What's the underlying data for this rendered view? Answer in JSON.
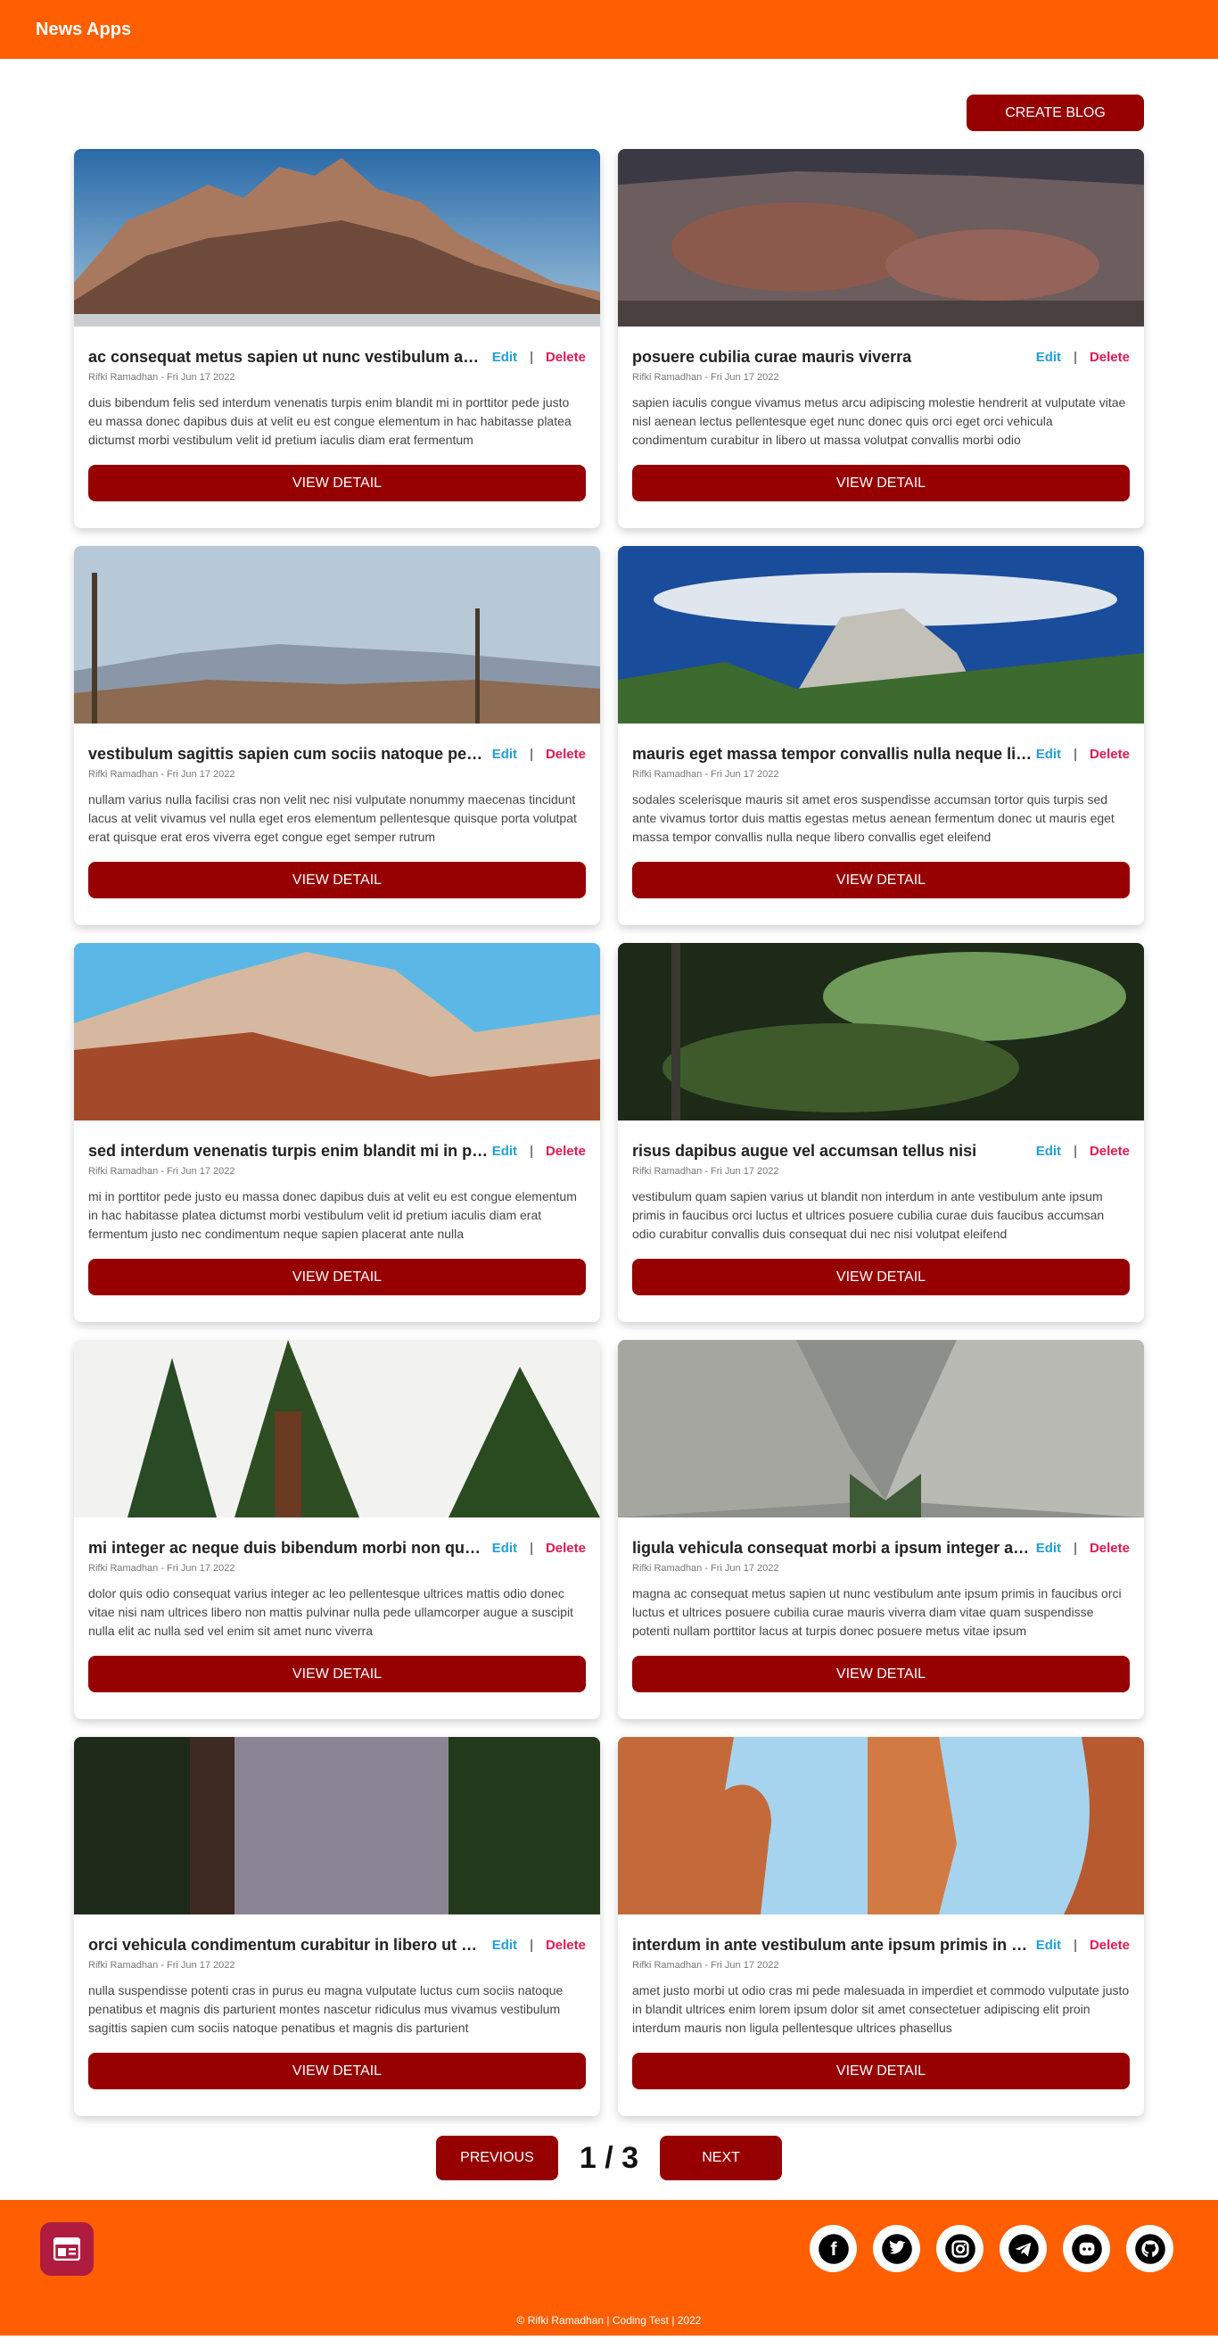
{
  "navbar": {
    "brand": "News Apps"
  },
  "toolbar": {
    "create_label": "CREATE BLOG"
  },
  "cards": [
    {
      "title": "ac consequat metus sapien ut nunc vestibulum ante ipsum primis in faucibus",
      "meta": "Rifki Ramadhan - Fri Jun 17 2022",
      "desc": "duis bibendum felis sed interdum venenatis turpis enim blandit mi in porttitor pede justo eu massa donec dapibus duis at velit eu est congue elementum in hac habitasse platea dictumst morbi vestibulum velit id pretium iaculis diam erat fermentum",
      "image": "mountain"
    },
    {
      "title": "posuere cubilia curae mauris viverra",
      "meta": "Rifki Ramadhan - Fri Jun 17 2022",
      "desc": "sapien iaculis congue vivamus metus arcu adipiscing molestie hendrerit at vulputate vitae nisl aenean lectus pellentesque eget nunc donec quis orci eget orci vehicula condimentum curabitur in libero ut massa volutpat convallis morbi odio",
      "image": "crater"
    },
    {
      "title": "vestibulum sagittis sapien cum sociis natoque penatibus et magnis",
      "meta": "Rifki Ramadhan - Fri Jun 17 2022",
      "desc": "nullam varius nulla facilisi cras non velit nec nisi vulputate nonummy maecenas tincidunt lacus at velit vivamus vel nulla eget eros elementum pellentesque quisque porta volutpat erat quisque erat eros viverra eget congue eget semper rutrum",
      "image": "hills"
    },
    {
      "title": "mauris eget massa tempor convallis nulla neque libero convallis",
      "meta": "Rifki Ramadhan - Fri Jun 17 2022",
      "desc": "sodales scelerisque mauris sit amet eros suspendisse accumsan tortor quis turpis sed ante vivamus tortor duis mattis egestas metus aenean fermentum donec ut mauris eget massa tempor convallis nulla neque libero convallis eget eleifend",
      "image": "valley"
    },
    {
      "title": "sed interdum venenatis turpis enim blandit mi in porttitor",
      "meta": "Rifki Ramadhan - Fri Jun 17 2022",
      "desc": "mi in porttitor pede justo eu massa donec dapibus duis at velit eu est congue elementum in hac habitasse platea dictumst morbi vestibulum velit id pretium iaculis diam erat fermentum justo nec condimentum neque sapien placerat ante nulla",
      "image": "canyon"
    },
    {
      "title": "risus dapibus augue vel accumsan tellus nisi",
      "meta": "Rifki Ramadhan - Fri Jun 17 2022",
      "desc": "vestibulum quam sapien varius ut blandit non interdum in ante vestibulum ante ipsum primis in faucibus orci luctus et ultrices posuere cubilia curae duis faucibus accumsan odio curabitur convallis duis consequat dui nec nisi volutpat eleifend",
      "image": "fern"
    },
    {
      "title": "mi integer ac neque duis bibendum morbi non quam nec dui luctus",
      "meta": "Rifki Ramadhan - Fri Jun 17 2022",
      "desc": "dolor quis odio consequat varius integer ac leo pellentesque ultrices mattis odio donec vitae nisi nam ultrices libero non mattis pulvinar nulla pede ullamcorper augue a suscipit nulla elit ac nulla sed vel enim sit amet nunc viverra",
      "image": "redwood"
    },
    {
      "title": "ligula vehicula consequat morbi a ipsum integer a nibh",
      "meta": "Rifki Ramadhan - Fri Jun 17 2022",
      "desc": "magna ac consequat metus sapien ut nunc vestibulum ante ipsum primis in faucibus orci luctus et ultrices posuere cubilia curae mauris viverra diam vitae quam suspendisse potenti nullam porttitor lacus at turpis donec posuere metus vitae ipsum",
      "image": "glacier"
    },
    {
      "title": "orci vehicula condimentum curabitur in libero ut massa volutpat",
      "meta": "Rifki Ramadhan - Fri Jun 17 2022",
      "desc": "nulla suspendisse potenti cras in purus eu magna vulputate luctus cum sociis natoque penatibus et magnis dis parturient montes nascetur ridiculus mus vivamus vestibulum sagittis sapien cum sociis natoque penatibus et magnis dis parturient",
      "image": "forest"
    },
    {
      "title": "interdum in ante vestibulum ante ipsum primis in faucibus orci",
      "meta": "Rifki Ramadhan - Fri Jun 17 2022",
      "desc": "amet justo morbi ut odio cras mi pede malesuada in imperdiet et commodo vulputate justo in blandit ultrices enim lorem ipsum dolor sit amet consectetuer adipiscing elit proin interdum mauris non ligula pellentesque ultrices phasellus",
      "image": "arch"
    }
  ],
  "labels": {
    "edit": "Edit",
    "separator": "|",
    "delete": "Delete",
    "view": "VIEW DETAIL"
  },
  "pagination": {
    "prev_label": "PREVIOUS",
    "indicator": "1 / 3",
    "next_label": "NEXT"
  },
  "footer": {
    "copyright": "© Rifki Ramadhan | Coding Test | 2022",
    "socials": [
      "facebook-icon",
      "twitter-icon",
      "instagram-icon",
      "telegram-icon",
      "discord-icon",
      "github-icon"
    ]
  }
}
